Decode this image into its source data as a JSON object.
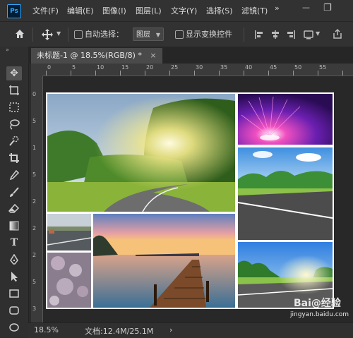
{
  "app": {
    "logo": "Ps"
  },
  "menubar": {
    "items": [
      "文件(F)",
      "编辑(E)",
      "图像(I)",
      "图层(L)",
      "文字(Y)",
      "选择(S)",
      "滤镜(T)"
    ],
    "more": "»",
    "minimize": "—",
    "restore": "❐"
  },
  "options": {
    "home_icon": "home-icon",
    "move_icon": "move-icon",
    "auto_select_label": "自动选择：",
    "auto_select_value": "图层",
    "show_transform_label": "显示变换控件"
  },
  "document": {
    "tab_title": "未标题-1 @ 18.5%(RGB/8) *",
    "close": "×"
  },
  "ruler": {
    "top_ticks": [
      "0",
      "5",
      "10",
      "15",
      "20",
      "25",
      "30",
      "35",
      "40",
      "45",
      "50",
      "55"
    ],
    "left_ticks": [
      "0",
      "5",
      "1",
      "5",
      "2",
      "2",
      "2",
      "5",
      "3"
    ]
  },
  "status": {
    "zoom": "18.5%",
    "doc_info": "文档:12.4M/25.1M",
    "arrow": "›"
  },
  "watermark": {
    "brand": "Bai@经验",
    "url": "jingyan.baidu.com"
  },
  "colors": {
    "accent": "#31a8ff",
    "background": "#2b2b2b"
  }
}
